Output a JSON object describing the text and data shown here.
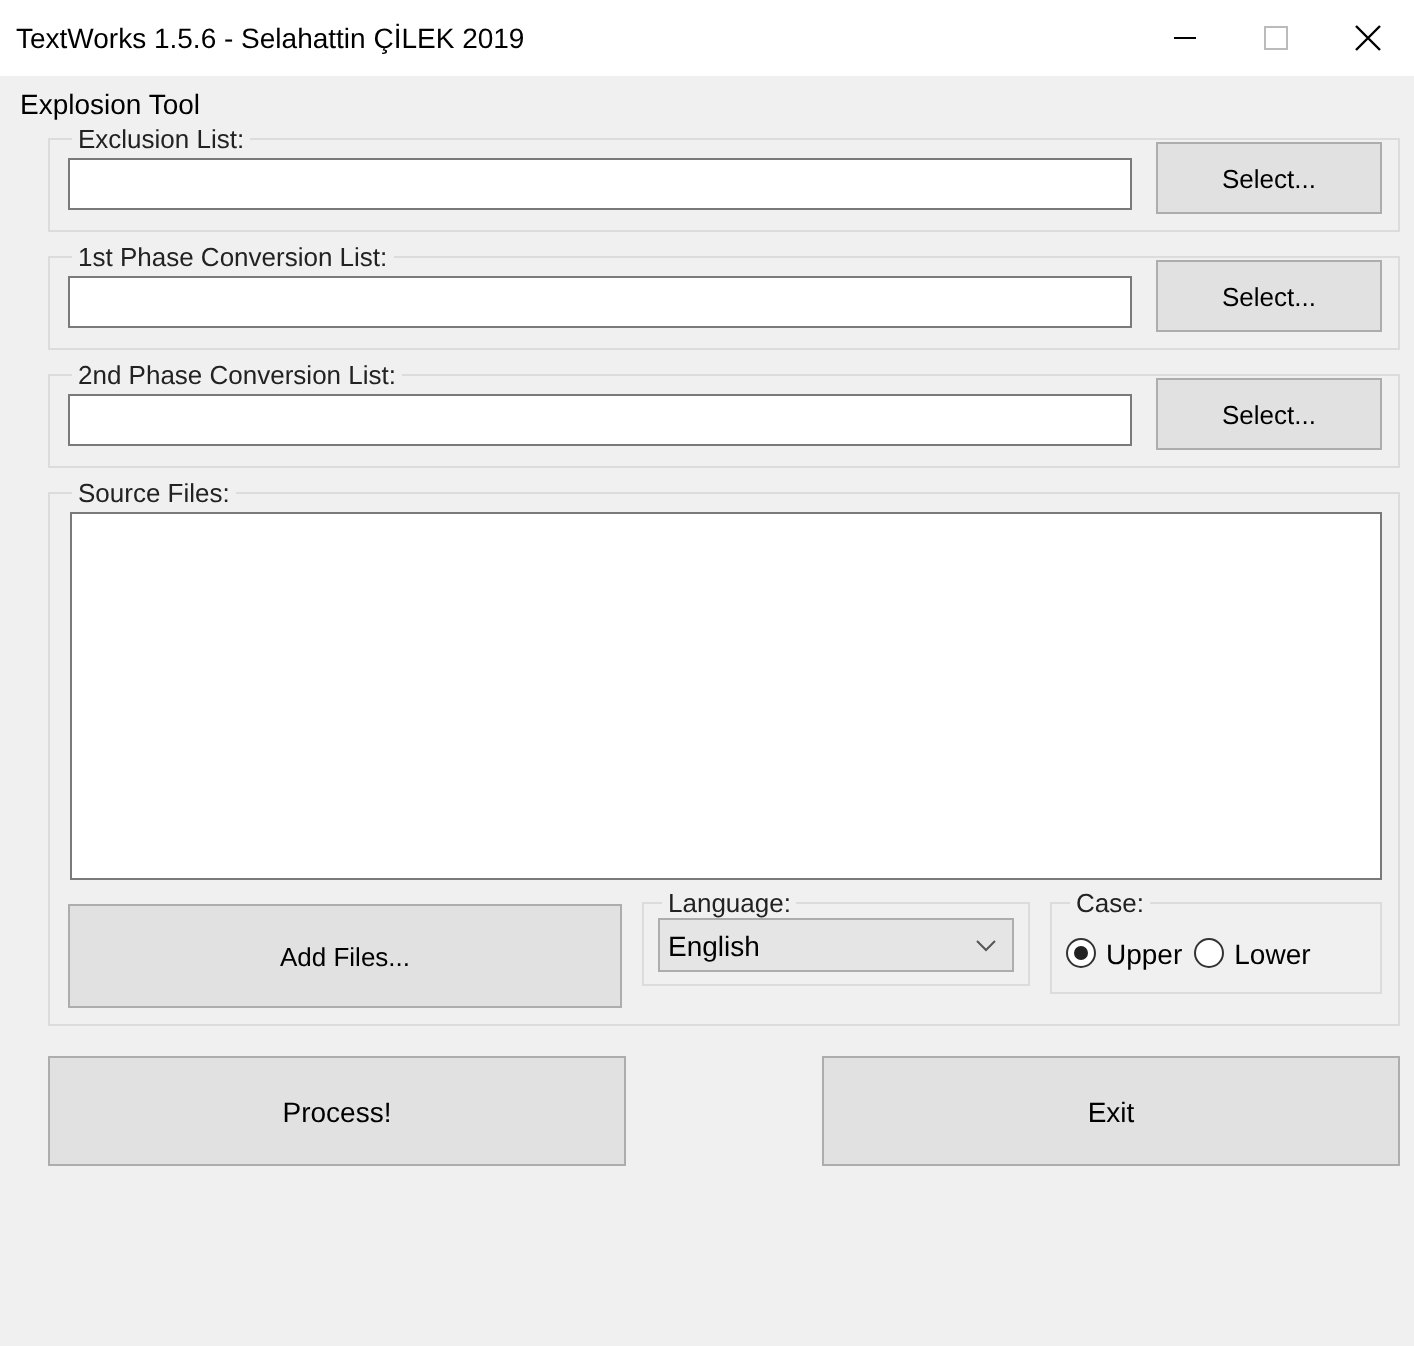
{
  "window": {
    "title": "TextWorks 1.5.6 - Selahattin ÇİLEK 2019"
  },
  "heading": "Explosion Tool",
  "file_lists": [
    {
      "label": "Exclusion List:",
      "button": "Select..."
    },
    {
      "label": "1st Phase Conversion List:",
      "button": "Select..."
    },
    {
      "label": "2nd Phase Conversion List:",
      "button": "Select..."
    }
  ],
  "source_files": {
    "label": "Source Files:",
    "add_button": "Add Files..."
  },
  "language": {
    "label": "Language:",
    "value": "English"
  },
  "case": {
    "label": "Case:",
    "options": [
      {
        "label": "Upper",
        "selected": true
      },
      {
        "label": "Lower",
        "selected": false
      }
    ]
  },
  "buttons": [
    "Process!",
    "Exit"
  ]
}
